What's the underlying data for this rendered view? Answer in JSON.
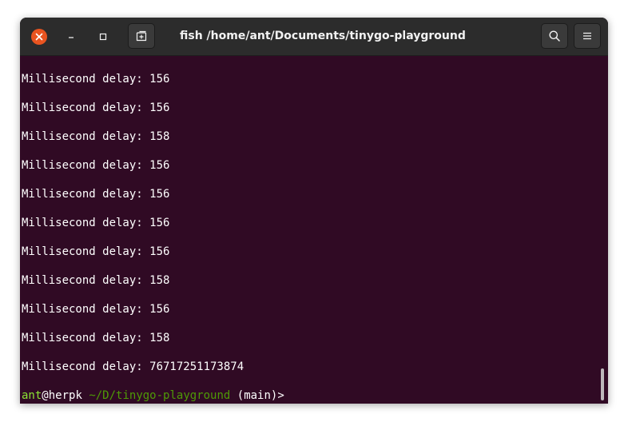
{
  "window": {
    "title": "fish /home/ant/Documents/tinygo-playground"
  },
  "titlebar": {
    "close_icon": "close-icon",
    "minimize_icon": "minimize-icon",
    "maximize_icon": "maximize-icon",
    "new_tab_icon": "new-tab-icon",
    "search_icon": "search-icon",
    "menu_icon": "hamburger-menu-icon"
  },
  "terminal": {
    "lines": [
      "Millisecond delay: 156",
      "",
      "Millisecond delay: 156",
      "",
      "Millisecond delay: 158",
      "",
      "Millisecond delay: 156",
      "",
      "Millisecond delay: 156",
      "",
      "Millisecond delay: 156",
      "",
      "Millisecond delay: 156",
      "",
      "Millisecond delay: 158",
      "",
      "Millisecond delay: 156",
      "",
      "Millisecond delay: 158",
      "",
      "Millisecond delay: 76717251173874",
      ""
    ],
    "prompt": {
      "user": "ant",
      "at": "@",
      "host": "herpk",
      "path": "~/D/tinygo-playground",
      "rest": " (main)>"
    }
  },
  "colors": {
    "terminal_bg": "#300a24",
    "titlebar_bg": "#2c2c2c",
    "close_button": "#e95420",
    "prompt_user": "#8ae234",
    "prompt_path": "#4e9a06"
  }
}
